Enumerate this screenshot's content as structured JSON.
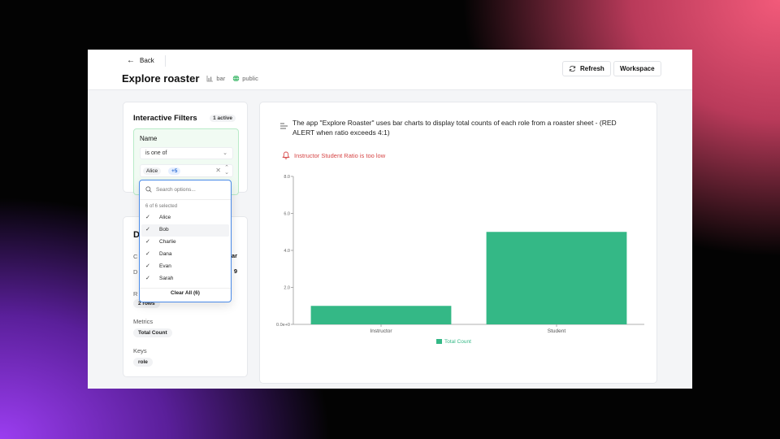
{
  "header": {
    "back_label": "Back",
    "title": "Explore roaster",
    "chart_type": "bar",
    "visibility": "public",
    "refresh_label": "Refresh",
    "workspace_label": "Workspace"
  },
  "filters": {
    "title": "Interactive Filters",
    "active_badge": "1 active",
    "field_label": "Name",
    "operator": "is one of",
    "selected_chip": "Alice",
    "more_chip": "+5"
  },
  "dropdown": {
    "search_placeholder": "Search options...",
    "count_text": "6 of 6 selected",
    "options": [
      "Alice",
      "Bob",
      "Charlie",
      "Dana",
      "Evan",
      "Sarah"
    ],
    "clear_label": "Clear All (6)"
  },
  "details": {
    "heading_initial": "D",
    "row1_initial": "C",
    "row1_value_tail": "ar",
    "row2_initial": "D",
    "row2_value_tail": "9",
    "row3_initial": "R",
    "rows_pill": "2 rows",
    "metrics_label": "Metrics",
    "metrics_pill": "Total Count",
    "keys_label": "Keys",
    "keys_pill": "role"
  },
  "chart": {
    "description": "The app \"Explore Roaster\" uses bar charts to display total counts of each role from a roaster sheet - (RED ALERT when ratio exceeds 4:1)",
    "alert_text": "Instructor Student Ratio is too low",
    "alert_color": "#d64545",
    "bar_color": "#34b886"
  },
  "chart_data": {
    "type": "bar",
    "categories": [
      "Instructor",
      "Student"
    ],
    "series": [
      {
        "name": "Total Count",
        "values": [
          1,
          5
        ]
      }
    ],
    "ylim": [
      0,
      8
    ],
    "yticks": [
      0,
      2,
      4,
      6,
      8
    ],
    "ytick_labels": [
      "0.0e+0",
      "2.0",
      "4.0",
      "6.0",
      "8.0"
    ],
    "legend_position": "bottom",
    "grid": false
  }
}
